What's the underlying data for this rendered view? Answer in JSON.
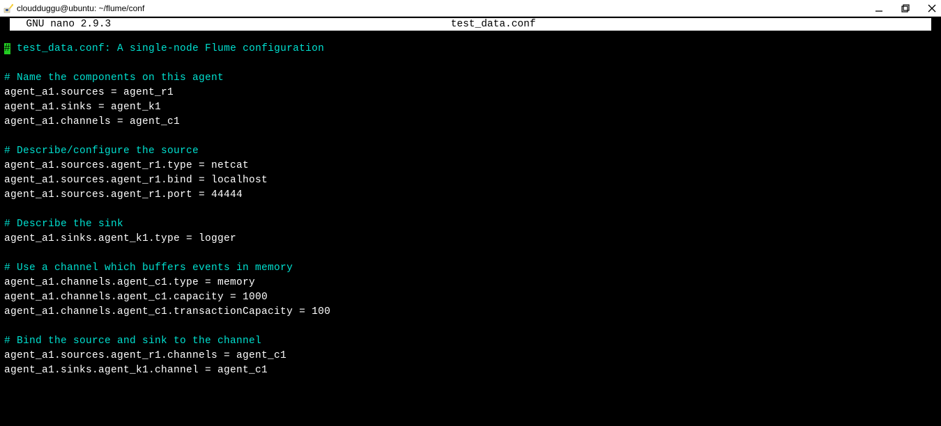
{
  "window": {
    "title": "cloudduggu@ubuntu: ~/flume/conf"
  },
  "nano": {
    "app": "  GNU nano 2.9.3",
    "file": "test_data.conf"
  },
  "editor": {
    "c1_prefix": "#",
    "c1_rest": " test_data.conf: A single-node Flume configuration",
    "c2": "# Name the components on this agent",
    "l1": "agent_a1.sources = agent_r1",
    "l2": "agent_a1.sinks = agent_k1",
    "l3": "agent_a1.channels = agent_c1",
    "c3": "# Describe/configure the source",
    "l4": "agent_a1.sources.agent_r1.type = netcat",
    "l5": "agent_a1.sources.agent_r1.bind = localhost",
    "l6": "agent_a1.sources.agent_r1.port = 44444",
    "c4": "# Describe the sink",
    "l7": "agent_a1.sinks.agent_k1.type = logger",
    "c5": "# Use a channel which buffers events in memory",
    "l8": "agent_a1.channels.agent_c1.type = memory",
    "l9": "agent_a1.channels.agent_c1.capacity = 1000",
    "l10": "agent_a1.channels.agent_c1.transactionCapacity = 100",
    "c6": "# Bind the source and sink to the channel",
    "l11": "agent_a1.sources.agent_r1.channels = agent_c1",
    "l12": "agent_a1.sinks.agent_k1.channel = agent_c1"
  }
}
